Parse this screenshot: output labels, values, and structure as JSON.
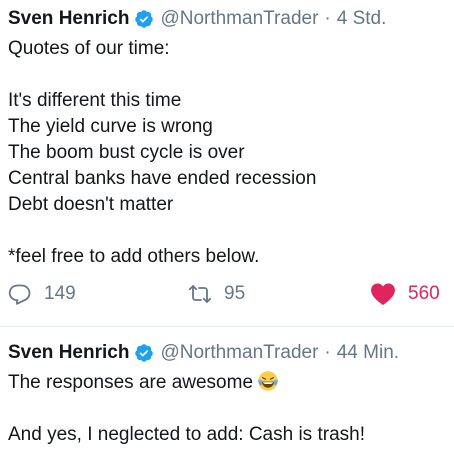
{
  "tweets": [
    {
      "display_name": "Sven Henrich",
      "handle": "@NorthmanTrader",
      "separator": "·",
      "time": "4 Std.",
      "lines": [
        "Quotes of our time:",
        "",
        "It's different this time",
        "The yield curve is wrong",
        "The boom bust cycle is over",
        "Central banks have ended recession",
        "Debt doesn't matter",
        "",
        "*feel free to add others below."
      ],
      "reply_count": "149",
      "retweet_count": "95",
      "like_count": "560",
      "liked": true
    },
    {
      "display_name": "Sven Henrich",
      "handle": "@NorthmanTrader",
      "separator": "·",
      "time": "44 Min.",
      "line_1": "The responses are awesome",
      "line_1_emoji": "face-with-tears-of-joy",
      "line_2": "",
      "line_3": "And yes, I neglected to add: Cash is trash!"
    }
  ],
  "colors": {
    "text": "#14171a",
    "muted": "#657786",
    "verified": "#1da1f2",
    "like": "#e0245e"
  }
}
